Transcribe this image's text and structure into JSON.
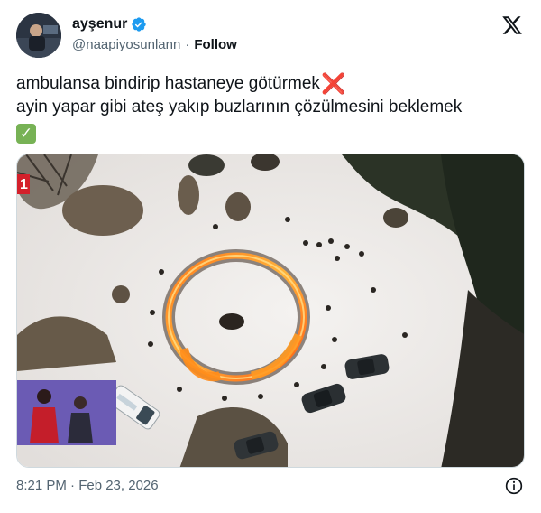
{
  "author": {
    "display_name": "ayşenur",
    "handle": "@naapiyosunlann",
    "follow_label": "Follow",
    "separator": "·"
  },
  "icons": {
    "verified": "verified-badge-icon",
    "platform": "x-logo-icon",
    "info": "info-icon",
    "cross_emoji": "cross-mark-emoji",
    "check_emoji": "check-mark-emoji"
  },
  "tweet": {
    "line1": "ambulansa bindirip hastaneye götürmek",
    "line1_emoji": "❌",
    "line2": "ayin yapar gibi ateş yakıp buzlarının çözülmesini beklemek",
    "line3_emoji": "✓"
  },
  "media": {
    "channel_logo_text": "1",
    "type": "aerial photo of a ring of fire on snow with parked cars"
  },
  "meta": {
    "timestamp": "8:21 PM · Feb 23, 2026"
  },
  "colors": {
    "verified_blue": "#1d9bf0",
    "text_primary": "#0f1419",
    "text_secondary": "#536471",
    "check_green": "#77b255",
    "cross_red": "#e0245e"
  }
}
